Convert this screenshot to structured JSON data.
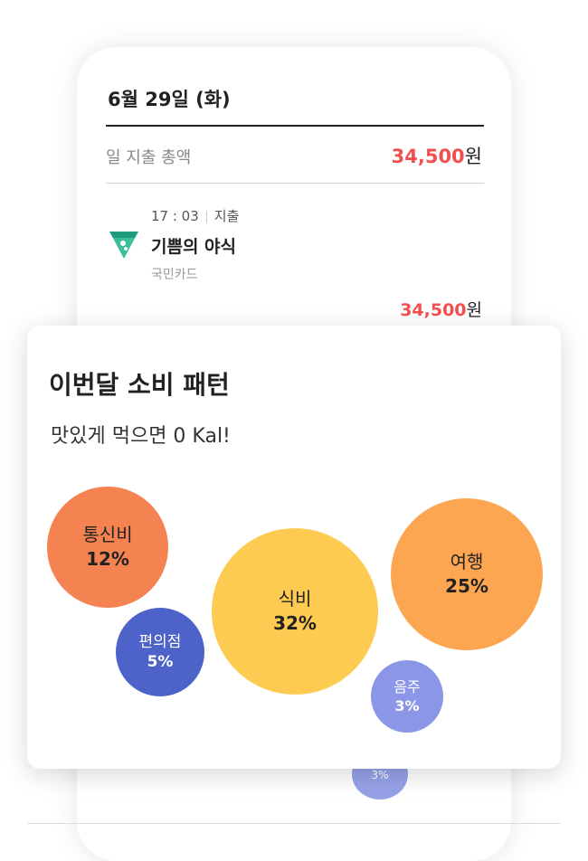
{
  "receipt": {
    "date": "6월 29일 (화)",
    "total_label": "일 지출 총액",
    "total_amount": "34,500",
    "currency": "원",
    "transaction": {
      "time": "17 : 03",
      "type": "지출",
      "merchant": "기쁨의 야식",
      "payment": "국민카드",
      "amount": "34,500",
      "currency": "원"
    },
    "peek_bubble_pct": "3%"
  },
  "pattern": {
    "title": "이번달 소비 패턴",
    "subtitle": "맛있게 먹으면 0 Kal!",
    "bubbles": [
      {
        "name": "통신비",
        "pct": "12%",
        "color": "#f58351"
      },
      {
        "name": "편의점",
        "pct": "5%",
        "color": "#4e63c9"
      },
      {
        "name": "식비",
        "pct": "32%",
        "color": "#fecb52"
      },
      {
        "name": "여행",
        "pct": "25%",
        "color": "#fda652"
      },
      {
        "name": "음주",
        "pct": "3%",
        "color": "#8b97e6"
      }
    ]
  },
  "colors": {
    "accent_red": "#f0504f",
    "icon_green": "#3bbf9b"
  },
  "icons": {
    "merchant": "food-delivery-icon"
  }
}
